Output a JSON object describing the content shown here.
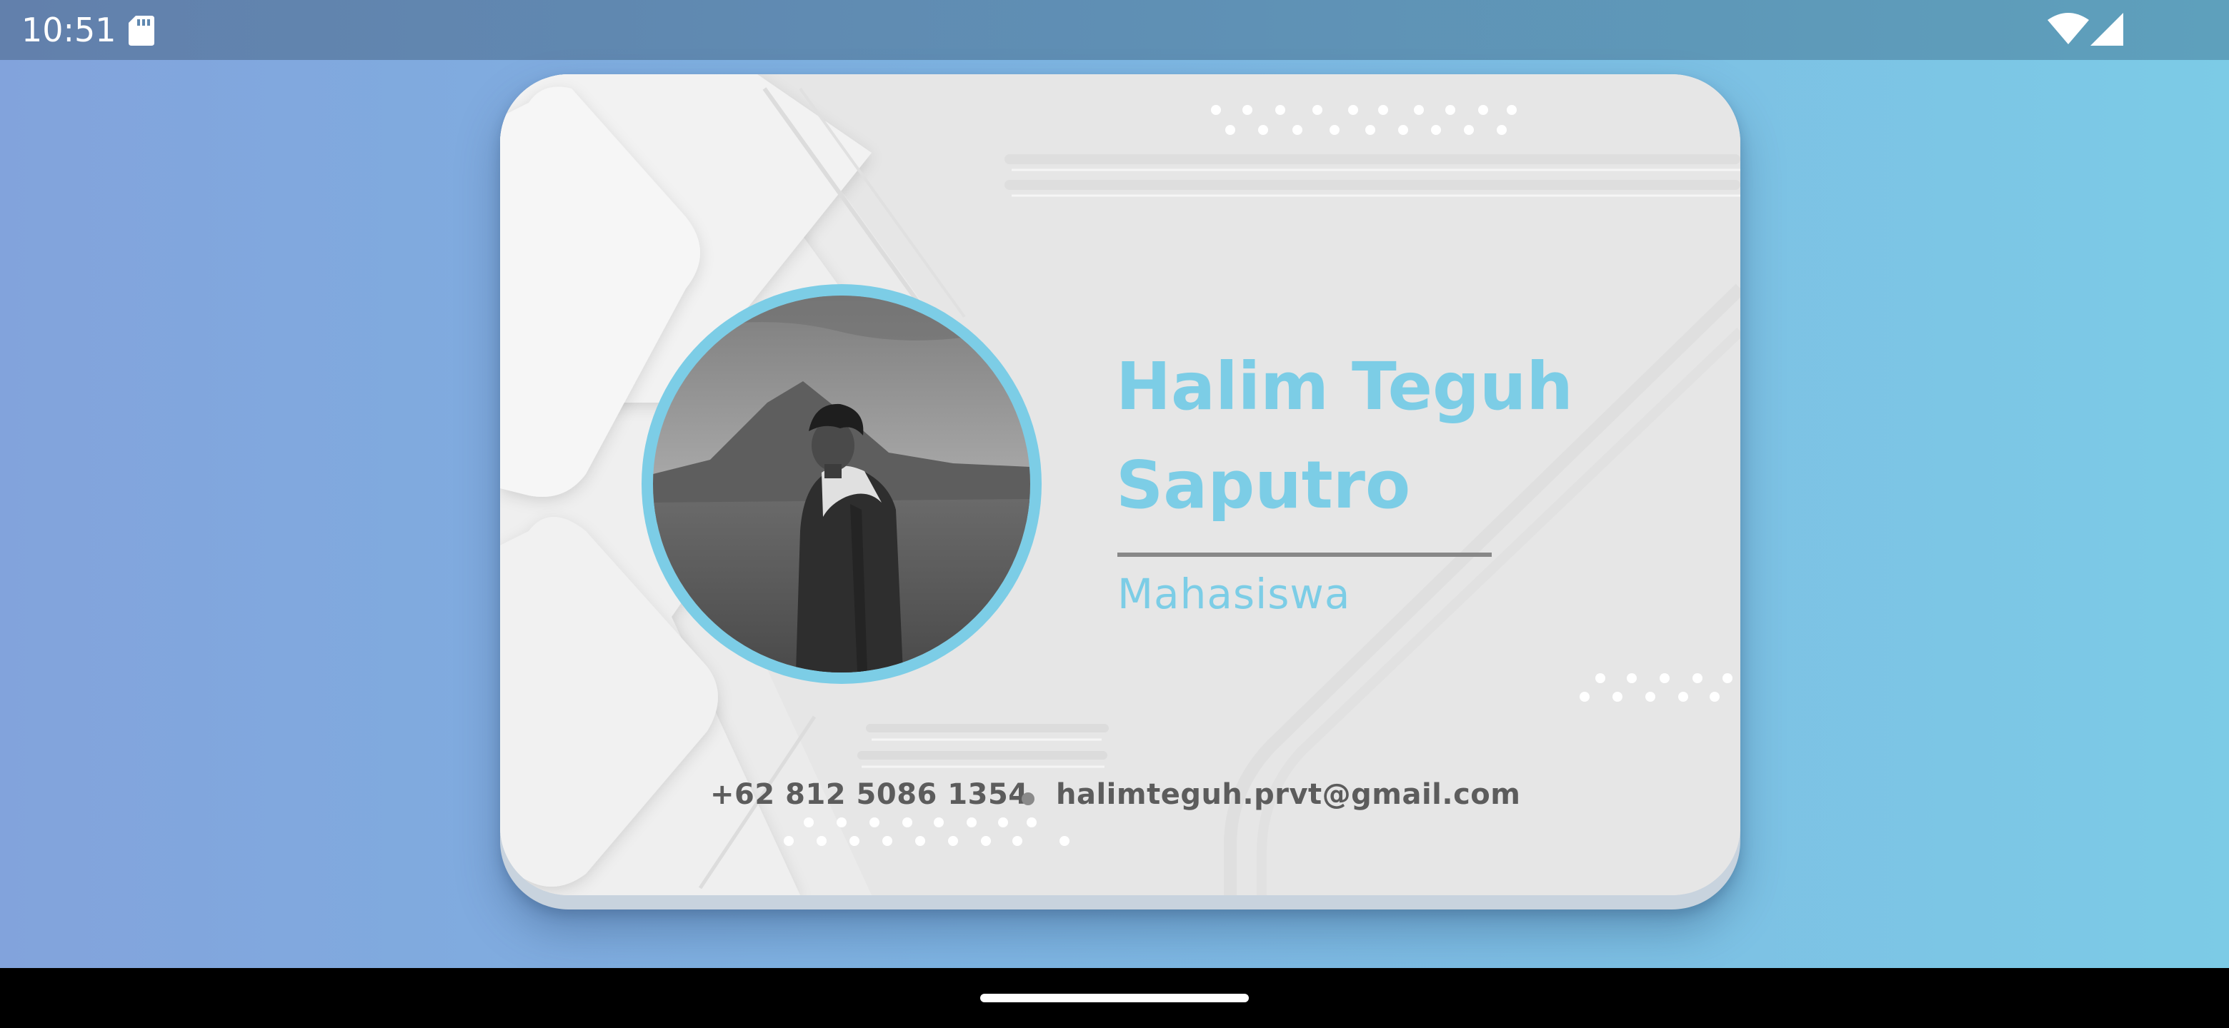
{
  "status_bar": {
    "time": "10:51",
    "icons": [
      "sd-card-icon",
      "wifi-icon",
      "cell-signal-icon"
    ]
  },
  "profile": {
    "name_line_1": "Halim Teguh",
    "name_line_2": "Saputro",
    "role": "Mahasiswa",
    "phone": "+62 812 5086 1354",
    "email": "halimteguh.prvt@gmail.com",
    "photo": "profile-photo"
  },
  "colors": {
    "accent": "#7ccde6",
    "card": "#e6e6e6",
    "text_dark": "#5c5c5c",
    "background_left": "#82a3dc",
    "background_right": "#7ccbe6"
  },
  "navigation": {
    "handle": "home-gesture-handle"
  }
}
